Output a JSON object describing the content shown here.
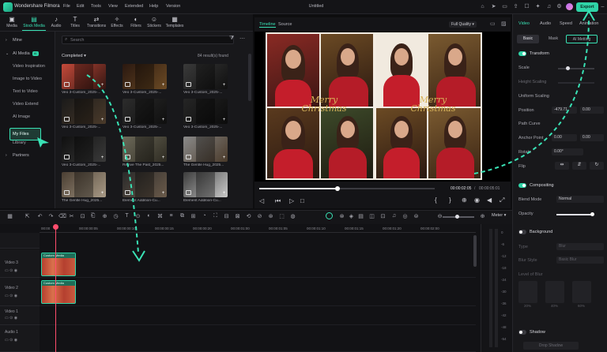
{
  "app": {
    "name": "Wondershare Filmora",
    "window_title": "Untitled"
  },
  "menu": [
    "File",
    "Edit",
    "Tools",
    "View",
    "Extended",
    "Help",
    "Version"
  ],
  "export_label": "Export",
  "toolbar": [
    {
      "label": "Media",
      "icon": "media-icon"
    },
    {
      "label": "Stock Media",
      "icon": "stock-media-icon"
    },
    {
      "label": "Audio",
      "icon": "audio-icon"
    },
    {
      "label": "Titles",
      "icon": "titles-icon"
    },
    {
      "label": "Transitions",
      "icon": "transitions-icon"
    },
    {
      "label": "Effects",
      "icon": "effects-icon"
    },
    {
      "label": "Filters",
      "icon": "filters-icon"
    },
    {
      "label": "Stickers",
      "icon": "stickers-icon"
    },
    {
      "label": "Templates",
      "icon": "templates-icon"
    }
  ],
  "sidebar": {
    "mine": "Mine",
    "ai_media": "AI Media",
    "ai_badge": "AI",
    "sub_items": [
      "Video Inspiration",
      "Image to Video",
      "Text to Video",
      "Video Extend",
      "AI Image"
    ],
    "my_files": "My Files",
    "library": "Library",
    "partners": "Partners"
  },
  "media": {
    "search_placeholder": "Search",
    "section": "Completed",
    "result_count": "84 result(s) found",
    "items": [
      "Veo 3-Custom_2025-...",
      "Veo 3-Custom_2025-...",
      "Veo 3-Custom_2025-...",
      "Veo 3-Custom_2025-...",
      "Veo 3-Custom_2025-...",
      "Veo 3-Custom_2025-...",
      "Veo 3-Custom_2025-...",
      "Revive The Past_2025...",
      "The Gentle Hug_2025...",
      "The Gentle Hug_2025...",
      "Element Addition-Cu...",
      "Element Addition-Cu..."
    ]
  },
  "preview": {
    "tab_timeline": "Timeline",
    "tab_source": "Source",
    "quality": "Full Quality",
    "collage_text": [
      "Merry",
      "Christmas",
      "Merry",
      "Christmas"
    ],
    "current_time": "00:00:02:05",
    "total_time": "00:00:05:01"
  },
  "properties": {
    "tabs": [
      "Video",
      "Audio",
      "Speed",
      "Animation"
    ],
    "subtabs": [
      "Basic",
      "Mask",
      "AI Metting"
    ],
    "transform": "Transform",
    "scale": "Scale",
    "height_scaling": "Height Scaling",
    "uniform_scaling": "Uniform Scaling",
    "position": "Position",
    "position_x": "-479.71",
    "position_y": "0.00",
    "path_curve": "Path Curve",
    "anchor_point": "Anchor Point",
    "anchor_x": "0.00",
    "anchor_y": "0.00",
    "rotate": "Rotate",
    "rotate_value": "0.00°",
    "flip": "Flip",
    "compositing": "Compositing",
    "blend_mode": "Blend Mode",
    "blend_value": "Normal",
    "opacity": "Opacity",
    "background": "Background",
    "type": "Type",
    "type_value": "Blur",
    "blur_style": "Blur Style",
    "blur_style_value": "Basic Blur",
    "level_of_blur": "Level of Blur",
    "blur_presets": [
      "20%",
      "40%",
      "60%"
    ],
    "shadow": "Shadow",
    "drop_shadow": "Drop Shadow"
  },
  "timeline": {
    "ruler": [
      "00:00",
      "00:00:00:05",
      "00:00:00:10",
      "00:00:00:15",
      "00:00:00:20",
      "00:00:01:00",
      "00:00:01:05",
      "00:00:01:10",
      "00:00:01:15",
      "00:00:01:20",
      "00:00:02:00"
    ],
    "tracks": [
      "Video 3",
      "Video 2",
      "Video 1",
      "Audio 1"
    ],
    "clip_label": "Custom Media",
    "meter_label": "Meter",
    "meter_scale": [
      "0",
      "-6",
      "-12",
      "-18",
      "-24",
      "-30",
      "-36",
      "-42",
      "-48",
      "-54"
    ]
  }
}
